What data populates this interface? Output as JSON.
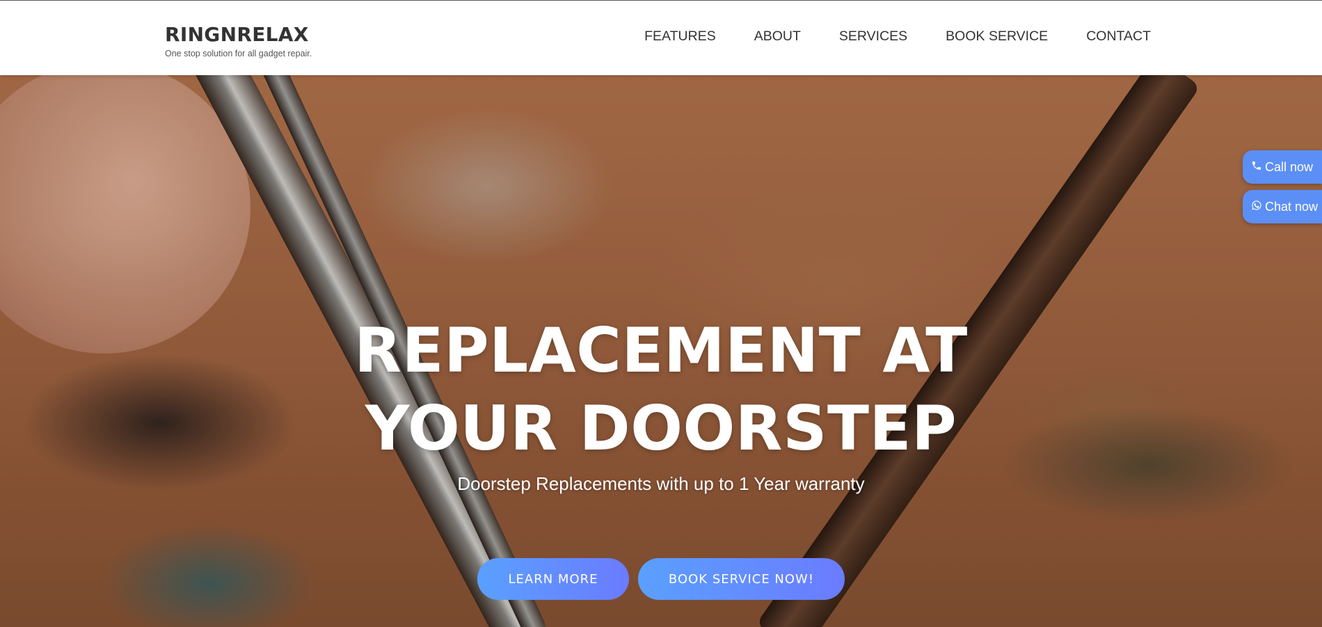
{
  "brand": {
    "name": "RINGNRELAX",
    "tagline": "One stop solution for all gadget repair."
  },
  "nav": {
    "items": [
      {
        "label": "FEATURES"
      },
      {
        "label": "ABOUT"
      },
      {
        "label": "SERVICES"
      },
      {
        "label": "BOOK SERVICE"
      },
      {
        "label": "CONTACT"
      }
    ]
  },
  "hero": {
    "title_line1": "REPLACEMENT AT",
    "title_line2": "YOUR DOORSTEP",
    "subtitle": "Doorstep Replacements with up to 1 Year warranty",
    "learn_more_label": "LEARN MORE",
    "book_now_label": "BOOK SERVICE NOW!"
  },
  "floating": {
    "call_label": "Call now",
    "chat_label": "Chat now",
    "call_icon": "phone-icon",
    "chat_icon": "whatsapp-icon"
  },
  "colors": {
    "button_gradient_start": "#5aa0ff",
    "button_gradient_end": "#6b7bff",
    "floating_button": "#5c8ff5",
    "brand_text": "#333333"
  }
}
